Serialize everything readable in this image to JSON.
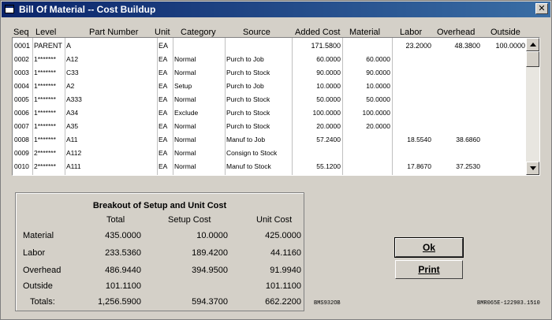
{
  "window": {
    "title": "Bill Of Material -- Cost Buildup",
    "close_glyph": "✕"
  },
  "columns": {
    "seq": "Seq",
    "level": "Level",
    "part_number": "Part Number",
    "unit": "Unit",
    "category": "Category",
    "source": "Source",
    "added_cost": "Added Cost",
    "material": "Material",
    "labor": "Labor",
    "overhead": "Overhead",
    "outside": "Outside"
  },
  "rows": [
    {
      "seq": "0001",
      "level": "PARENT",
      "part": "A",
      "unit": "EA",
      "category": "",
      "source": "",
      "added_cost": "171.5800",
      "material": "",
      "labor": "23.2000",
      "overhead": "48.3800",
      "outside": "100.0000"
    },
    {
      "seq": "0002",
      "level": "1*******",
      "part": "A12",
      "unit": "EA",
      "category": "Normal",
      "source": "Purch to Job",
      "added_cost": "60.0000",
      "material": "60.0000",
      "labor": "",
      "overhead": "",
      "outside": ""
    },
    {
      "seq": "0003",
      "level": "1*******",
      "part": "C33",
      "unit": "EA",
      "category": "Normal",
      "source": "Purch to Stock",
      "added_cost": "90.0000",
      "material": "90.0000",
      "labor": "",
      "overhead": "",
      "outside": ""
    },
    {
      "seq": "0004",
      "level": "1*******",
      "part": "A2",
      "unit": "EA",
      "category": "Setup",
      "source": "Purch to Job",
      "added_cost": "10.0000",
      "material": "10.0000",
      "labor": "",
      "overhead": "",
      "outside": ""
    },
    {
      "seq": "0005",
      "level": "1*******",
      "part": "A333",
      "unit": "EA",
      "category": "Normal",
      "source": "Purch to Stock",
      "added_cost": "50.0000",
      "material": "50.0000",
      "labor": "",
      "overhead": "",
      "outside": ""
    },
    {
      "seq": "0006",
      "level": "1*******",
      "part": "A34",
      "unit": "EA",
      "category": "Exclude",
      "source": "Purch to Stock",
      "added_cost": "100.0000",
      "material": "100.0000",
      "labor": "",
      "overhead": "",
      "outside": ""
    },
    {
      "seq": "0007",
      "level": "1*******",
      "part": "A35",
      "unit": "EA",
      "category": "Normal",
      "source": "Purch to Stock",
      "added_cost": "20.0000",
      "material": "20.0000",
      "labor": "",
      "overhead": "",
      "outside": ""
    },
    {
      "seq": "0008",
      "level": "1*******",
      "part": "A11",
      "unit": "EA",
      "category": "Normal",
      "source": "Manuf to Job",
      "added_cost": "57.2400",
      "material": "",
      "labor": "18.5540",
      "overhead": "38.6860",
      "outside": ""
    },
    {
      "seq": "0009",
      "level": "2*******",
      "part": "A112",
      "unit": "EA",
      "category": "Normal",
      "source": "Consign to Stock",
      "added_cost": "",
      "material": "",
      "labor": "",
      "overhead": "",
      "outside": ""
    },
    {
      "seq": "0010",
      "level": "2*******",
      "part": "A111",
      "unit": "EA",
      "category": "Normal",
      "source": "Manuf to Stock",
      "added_cost": "55.1200",
      "material": "",
      "labor": "17.8670",
      "overhead": "37.2530",
      "outside": ""
    }
  ],
  "breakout": {
    "title": "Breakout of Setup and Unit Cost",
    "headers": {
      "total": "Total",
      "setup": "Setup Cost",
      "unit": "Unit Cost"
    },
    "rows": [
      {
        "label": "Material",
        "total": "435.0000",
        "setup": "10.0000",
        "unit": "425.0000"
      },
      {
        "label": "Labor",
        "total": "233.5360",
        "setup": "189.4200",
        "unit": "44.1160"
      },
      {
        "label": "Overhead",
        "total": "486.9440",
        "setup": "394.9500",
        "unit": "91.9940"
      },
      {
        "label": "Outside",
        "total": "101.1100",
        "setup": "",
        "unit": "101.1100"
      },
      {
        "label": "Totals:",
        "total": "1,256.5900",
        "setup": "594.3700",
        "unit": "662.2200"
      }
    ]
  },
  "buttons": {
    "ok": "Ok",
    "print": "Print"
  },
  "footer": {
    "left_code": "BMS932OB",
    "right_code": "BMR065E-122903.1510"
  }
}
